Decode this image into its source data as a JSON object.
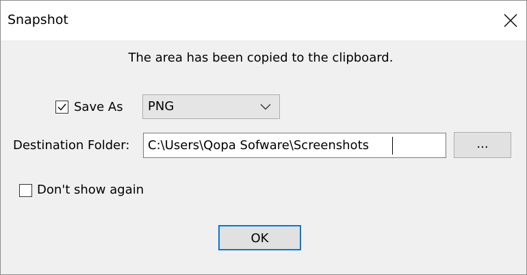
{
  "window": {
    "title": "Snapshot",
    "close_icon": "close-icon"
  },
  "message": "The area has been copied to the clipboard.",
  "save_as": {
    "label": "Save As",
    "checked": true,
    "format_value": "PNG",
    "chevron_icon": "chevron-down-icon"
  },
  "destination": {
    "label": "Destination Folder:",
    "value": "C:\\Users\\Qopa Sofware\\Screenshots",
    "browse_label": "..."
  },
  "dont_show": {
    "label": "Don't show again",
    "checked": false
  },
  "ok_label": "OK",
  "colors": {
    "dialog_bg": "#f0f0f0",
    "accent": "#0078d7",
    "button_bg": "#e1e1e1"
  }
}
